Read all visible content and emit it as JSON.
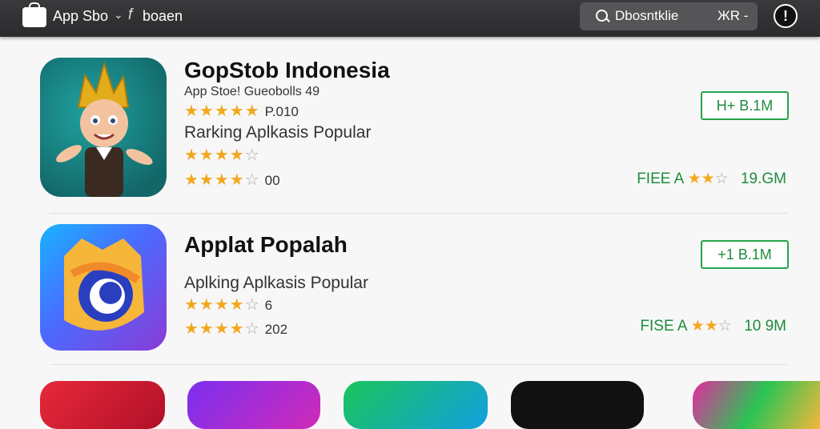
{
  "topbar": {
    "app_title": "App Sbo",
    "chevron": "⌄",
    "facebook_glyph": "f",
    "account": "boaen",
    "search_text": "Dbosntklie",
    "search_extra": "ЖR -",
    "alert_glyph": "!"
  },
  "apps": [
    {
      "name": "GopStob Indonesia",
      "subtitle": "App Stoe! Gueobolls 49",
      "rating_1_value": "P.010",
      "description": "Rarking Aplkasis Popular",
      "rating_3_value": "00",
      "get_label": "H+ B.1M",
      "price_label": "FIEE A",
      "size": "19.GM"
    },
    {
      "name": "Applat Popalah",
      "description": "Aplking Aplkasis Popular",
      "rating_1_value": "6",
      "rating_2_value": "202",
      "get_label": "+1 B.1M",
      "price_label": "FISE A",
      "size": "10 9M"
    }
  ],
  "icon_names": [
    "bag-icon",
    "facebook-icon",
    "search-icon",
    "alert-icon",
    "cartoon-mascot-icon",
    "colorful-swirl-icon"
  ],
  "colors": {
    "topbar": "#2f2f31",
    "star": "#f2a81d",
    "get_green": "#2aa34a"
  }
}
